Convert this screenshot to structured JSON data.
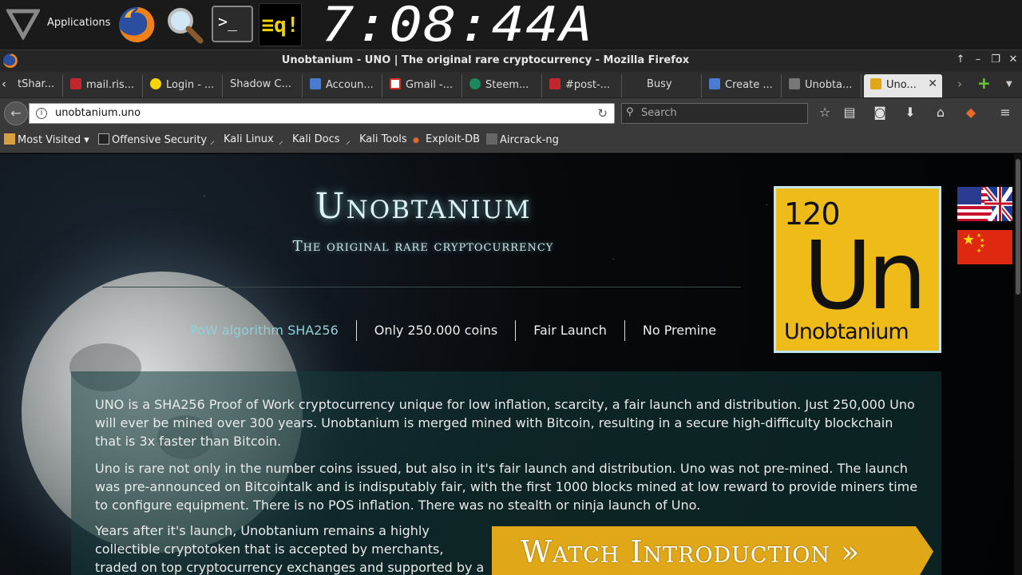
{
  "panel": {
    "applications_label": "Applications",
    "terminal_glyph": ">_",
    "cpu_monitor_glyph": "≡q!",
    "clock": "7:08:44A"
  },
  "window": {
    "title": "Unobtanium - UNO | The original rare cryptocurrency - Mozilla Firefox",
    "controls": [
      "↑",
      "–",
      "❐",
      "✕"
    ]
  },
  "tabs": [
    {
      "label": "tShar...",
      "icon": "pinned-tab-icon",
      "color": "#444"
    },
    {
      "label": "mail.ris...",
      "icon": "mail-tab-icon",
      "color": "#c0282d"
    },
    {
      "label": "Login - ...",
      "icon": "login-tab-icon",
      "color": "#f5d400"
    },
    {
      "label": "Shadow C...",
      "icon": "shadow-tab-icon",
      "color": "#2e2e2e"
    },
    {
      "label": "Accoun...",
      "icon": "account-tab-icon",
      "color": "#4a7bd0"
    },
    {
      "label": "Gmail -...",
      "icon": "gmail-tab-icon",
      "color": "#d93025"
    },
    {
      "label": "Steem...",
      "icon": "steem-tab-icon",
      "color": "#1a8a5a"
    },
    {
      "label": "#post-...",
      "icon": "post-tab-icon",
      "color": "#c0282d"
    },
    {
      "label": "Busy",
      "icon": "busy-tab-icon",
      "color": "#2e2e2e"
    },
    {
      "label": "Create ...",
      "icon": "create-tab-icon",
      "color": "#4a7bd0"
    },
    {
      "label": "Unobta...",
      "icon": "unobtanium-tab-icon",
      "color": "#777"
    },
    {
      "label": "Uno...",
      "icon": "unobtanium-active-tab-icon",
      "color": "#e0a818"
    }
  ],
  "tab_close": "✕",
  "nav": {
    "url": "unobtanium.uno",
    "search_placeholder": "Search"
  },
  "bookmarks": [
    {
      "label": "Most Visited",
      "icon": "folder-icon"
    },
    {
      "label": "Offensive Security",
      "icon": "offsec-icon"
    },
    {
      "label": "Kali Linux",
      "icon": "kali-icon"
    },
    {
      "label": "Kali Docs",
      "icon": "kali-icon"
    },
    {
      "label": "Kali Tools",
      "icon": "kali-icon"
    },
    {
      "label": "Exploit-DB",
      "icon": "exploitdb-icon"
    },
    {
      "label": "Aircrack-ng",
      "icon": "aircrack-icon"
    }
  ],
  "page": {
    "title": "Unobtanium",
    "subtitle": "The original rare cryptocurrency",
    "features": [
      "PoW algorithm SHA256",
      "Only 250.000 coins",
      "Fair Launch",
      "No Premine"
    ],
    "element": {
      "number": "120",
      "symbol": "Un",
      "name": "Unobtanium"
    },
    "paragraphs": [
      "UNO is a SHA256 Proof of Work cryptocurrency unique for low inflation, scarcity, a fair launch and distribution. Just 250,000 Uno will ever be mined over 300 years. Unobtanium is merged mined with Bitcoin, resulting in a secure high-difficulty blockchain that is 3x faster than Bitcoin.",
      "Uno is rare not only in the number coins issued, but also in it's fair launch and distribution. Uno was not pre-mined. The launch was pre-announced on Bitcointalk and is indisputably fair, with the first 1000 blocks mined at low reward to provide miners time to configure equipment. There is no POS inflation. There was no stealth or ninja launch of Uno.",
      "Years after it's launch, Unobtanium remains a highly collectible cryptotoken that is accepted by merchants, traded on top cryptocurrency exchanges and supported by a wide range of"
    ],
    "watch_button": "Watch Introduction »"
  },
  "colors": {
    "accent_gold": "#e0a818",
    "title_glow": "#8cdce6",
    "panel_bg": "#1a1a1a"
  }
}
